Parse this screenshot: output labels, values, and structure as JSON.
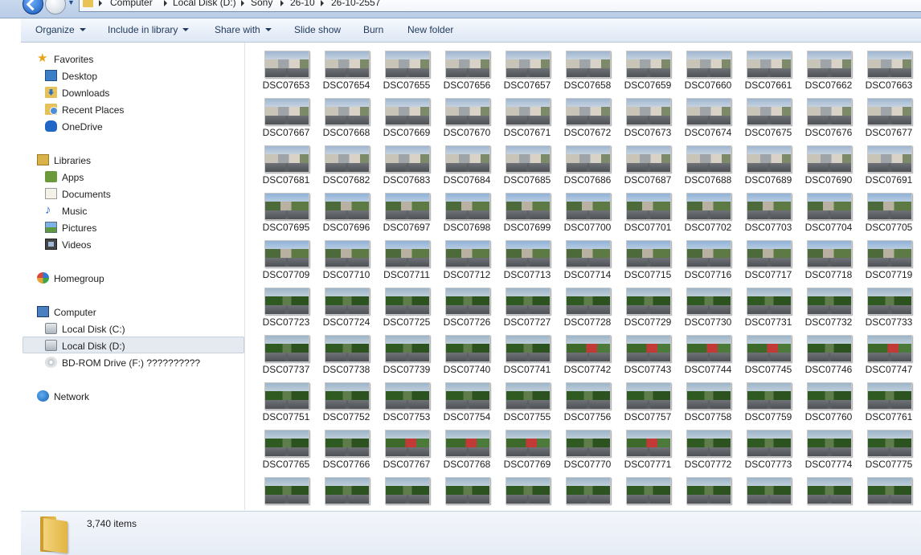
{
  "address": {
    "crumbs": [
      "Computer",
      "Local Disk (D:)",
      "Sony",
      "26-10",
      "26-10-2557"
    ]
  },
  "toolbar": {
    "organize": "Organize",
    "include_in_library": "Include in library",
    "share_with": "Share with",
    "slide_show": "Slide show",
    "burn": "Burn",
    "new_folder": "New folder"
  },
  "nav": {
    "favorites": "Favorites",
    "desktop": "Desktop",
    "downloads": "Downloads",
    "recent_places": "Recent Places",
    "onedrive": "OneDrive",
    "libraries": "Libraries",
    "apps": "Apps",
    "documents": "Documents",
    "music": "Music",
    "pictures": "Pictures",
    "videos": "Videos",
    "homegroup": "Homegroup",
    "computer": "Computer",
    "local_disk_c": "Local Disk (C:)",
    "local_disk_d": "Local Disk (D:)",
    "bd_rom": "BD-ROM Drive (F:) ??????????",
    "network": "Network",
    "selected": "Local Disk (D:)"
  },
  "files": [
    {
      "name": "DSC07653",
      "scene": "house"
    },
    {
      "name": "DSC07654",
      "scene": "house"
    },
    {
      "name": "DSC07655",
      "scene": "house"
    },
    {
      "name": "DSC07656",
      "scene": "house"
    },
    {
      "name": "DSC07657",
      "scene": "house"
    },
    {
      "name": "DSC07658",
      "scene": "house"
    },
    {
      "name": "DSC07659",
      "scene": "house"
    },
    {
      "name": "DSC07660",
      "scene": "house"
    },
    {
      "name": "DSC07661",
      "scene": "house"
    },
    {
      "name": "DSC07662",
      "scene": "house"
    },
    {
      "name": "DSC07663",
      "scene": "house"
    },
    {
      "name": "DSC07667",
      "scene": "house"
    },
    {
      "name": "DSC07668",
      "scene": "house"
    },
    {
      "name": "DSC07669",
      "scene": "house"
    },
    {
      "name": "DSC07670",
      "scene": "house"
    },
    {
      "name": "DSC07671",
      "scene": "house"
    },
    {
      "name": "DSC07672",
      "scene": "house"
    },
    {
      "name": "DSC07673",
      "scene": "house"
    },
    {
      "name": "DSC07674",
      "scene": "house"
    },
    {
      "name": "DSC07675",
      "scene": "house"
    },
    {
      "name": "DSC07676",
      "scene": "house"
    },
    {
      "name": "DSC07677",
      "scene": "house"
    },
    {
      "name": "DSC07681",
      "scene": "house"
    },
    {
      "name": "DSC07682",
      "scene": "house"
    },
    {
      "name": "DSC07683",
      "scene": "house"
    },
    {
      "name": "DSC07684",
      "scene": "house"
    },
    {
      "name": "DSC07685",
      "scene": "house"
    },
    {
      "name": "DSC07686",
      "scene": "house"
    },
    {
      "name": "DSC07687",
      "scene": "house"
    },
    {
      "name": "DSC07688",
      "scene": "house"
    },
    {
      "name": "DSC07689",
      "scene": "house"
    },
    {
      "name": "DSC07690",
      "scene": "house"
    },
    {
      "name": "DSC07691",
      "scene": "house"
    },
    {
      "name": "DSC07695",
      "scene": "mixed"
    },
    {
      "name": "DSC07696",
      "scene": "mixed"
    },
    {
      "name": "DSC07697",
      "scene": "mixed"
    },
    {
      "name": "DSC07698",
      "scene": "mixed"
    },
    {
      "name": "DSC07699",
      "scene": "mixed"
    },
    {
      "name": "DSC07700",
      "scene": "mixed"
    },
    {
      "name": "DSC07701",
      "scene": "mixed"
    },
    {
      "name": "DSC07702",
      "scene": "mixed"
    },
    {
      "name": "DSC07703",
      "scene": "mixed"
    },
    {
      "name": "DSC07704",
      "scene": "mixed"
    },
    {
      "name": "DSC07705",
      "scene": "mixed"
    },
    {
      "name": "DSC07709",
      "scene": "mixed"
    },
    {
      "name": "DSC07710",
      "scene": "mixed"
    },
    {
      "name": "DSC07711",
      "scene": "mixed"
    },
    {
      "name": "DSC07712",
      "scene": "mixed"
    },
    {
      "name": "DSC07713",
      "scene": "mixed"
    },
    {
      "name": "DSC07714",
      "scene": "mixed"
    },
    {
      "name": "DSC07715",
      "scene": "mixed"
    },
    {
      "name": "DSC07716",
      "scene": "mixed"
    },
    {
      "name": "DSC07717",
      "scene": "mixed"
    },
    {
      "name": "DSC07718",
      "scene": "mixed"
    },
    {
      "name": "DSC07719",
      "scene": "mixed"
    },
    {
      "name": "DSC07723",
      "scene": "tree"
    },
    {
      "name": "DSC07724",
      "scene": "tree"
    },
    {
      "name": "DSC07725",
      "scene": "tree"
    },
    {
      "name": "DSC07726",
      "scene": "tree"
    },
    {
      "name": "DSC07727",
      "scene": "tree"
    },
    {
      "name": "DSC07728",
      "scene": "tree"
    },
    {
      "name": "DSC07729",
      "scene": "tree"
    },
    {
      "name": "DSC07730",
      "scene": "tree"
    },
    {
      "name": "DSC07731",
      "scene": "tree"
    },
    {
      "name": "DSC07732",
      "scene": "tree"
    },
    {
      "name": "DSC07733",
      "scene": "tree"
    },
    {
      "name": "DSC07737",
      "scene": "tree"
    },
    {
      "name": "DSC07738",
      "scene": "tree"
    },
    {
      "name": "DSC07739",
      "scene": "tree"
    },
    {
      "name": "DSC07740",
      "scene": "tree"
    },
    {
      "name": "DSC07741",
      "scene": "tree"
    },
    {
      "name": "DSC07742",
      "scene": "red"
    },
    {
      "name": "DSC07743",
      "scene": "red"
    },
    {
      "name": "DSC07744",
      "scene": "red"
    },
    {
      "name": "DSC07745",
      "scene": "red"
    },
    {
      "name": "DSC07746",
      "scene": "tree"
    },
    {
      "name": "DSC07747",
      "scene": "red"
    },
    {
      "name": "DSC07751",
      "scene": "tree"
    },
    {
      "name": "DSC07752",
      "scene": "tree"
    },
    {
      "name": "DSC07753",
      "scene": "tree"
    },
    {
      "name": "DSC07754",
      "scene": "tree"
    },
    {
      "name": "DSC07755",
      "scene": "tree"
    },
    {
      "name": "DSC07756",
      "scene": "tree"
    },
    {
      "name": "DSC07757",
      "scene": "tree"
    },
    {
      "name": "DSC07758",
      "scene": "tree"
    },
    {
      "name": "DSC07759",
      "scene": "tree"
    },
    {
      "name": "DSC07760",
      "scene": "tree"
    },
    {
      "name": "DSC07761",
      "scene": "tree"
    },
    {
      "name": "DSC07765",
      "scene": "tree"
    },
    {
      "name": "DSC07766",
      "scene": "tree"
    },
    {
      "name": "DSC07767",
      "scene": "red"
    },
    {
      "name": "DSC07768",
      "scene": "red"
    },
    {
      "name": "DSC07769",
      "scene": "red"
    },
    {
      "name": "DSC07770",
      "scene": "tree"
    },
    {
      "name": "DSC07771",
      "scene": "red"
    },
    {
      "name": "DSC07772",
      "scene": "tree"
    },
    {
      "name": "DSC07773",
      "scene": "tree"
    },
    {
      "name": "DSC07774",
      "scene": "tree"
    },
    {
      "name": "DSC07775",
      "scene": "tree"
    }
  ],
  "status": {
    "item_count": "3,740 items"
  }
}
